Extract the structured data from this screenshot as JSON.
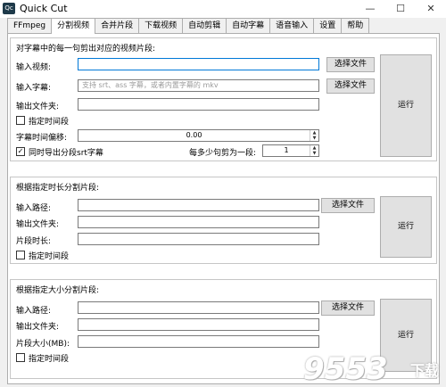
{
  "window": {
    "title": "Quick Cut",
    "icon_text": "Qc",
    "minimize": "—",
    "maximize": "☐",
    "close": "✕"
  },
  "tabs": [
    "FFmpeg",
    "分割视频",
    "合并片段",
    "下载视频",
    "自动剪辑",
    "自动字幕",
    "语音输入",
    "设置",
    "帮助"
  ],
  "active_tab": "分割视频",
  "section1": {
    "title": "对字幕中的每一句剪出对应的视频片段:",
    "input_video_label": "输入视频:",
    "input_video_value": "",
    "input_subtitle_label": "输入字幕:",
    "input_subtitle_placeholder": "支持 srt、ass 字幕，或者内置字幕的 mkv",
    "choose_file": "选择文件",
    "output_folder_label": "输出文件夹:",
    "specify_time": "指定时间段",
    "subtitle_offset_label": "字幕时间偏移:",
    "subtitle_offset_value": "0.00",
    "export_srt_label": "同时导出分段srt字幕",
    "export_srt_checked": true,
    "sentences_label": "每多少句剪为一段:",
    "sentences_value": "1",
    "run": "运行"
  },
  "section2": {
    "title": "根据指定时长分割片段:",
    "input_path_label": "输入路径:",
    "choose_file": "选择文件",
    "output_folder_label": "输出文件夹:",
    "segment_length_label": "片段时长:",
    "specify_time": "指定时间段",
    "run": "运行"
  },
  "section3": {
    "title": "根据指定大小分割片段:",
    "input_path_label": "输入路径:",
    "choose_file": "选择文件",
    "output_folder_label": "输出文件夹:",
    "segment_size_label": "片段大小(MB):",
    "specify_time": "指定时间段",
    "run": "运行"
  },
  "watermark": {
    "main": "9553",
    "sub": "下载"
  }
}
